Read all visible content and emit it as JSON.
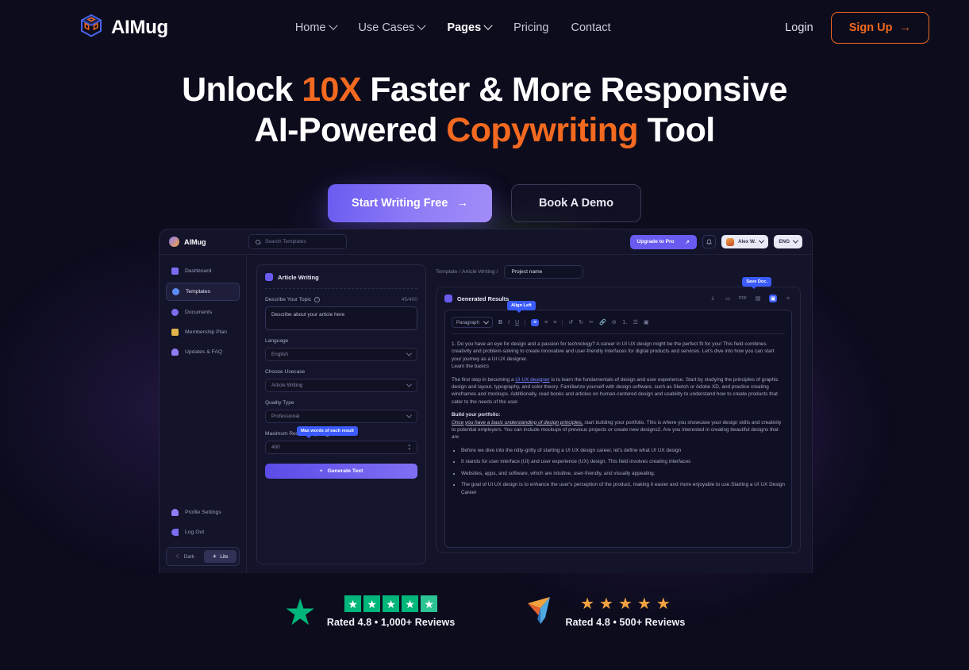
{
  "brand": {
    "name": "AIMug",
    "logo_icon": "cube-logo-icon"
  },
  "nav": {
    "items": [
      {
        "label": "Home",
        "has_caret": true,
        "active": false
      },
      {
        "label": "Use Cases",
        "has_caret": true,
        "active": false
      },
      {
        "label": "Pages",
        "has_caret": true,
        "active": true
      },
      {
        "label": "Pricing",
        "has_caret": false,
        "active": false
      },
      {
        "label": "Contact",
        "has_caret": false,
        "active": false
      }
    ],
    "login": "Login",
    "signup": "Sign Up",
    "signup_arrow": "→"
  },
  "hero": {
    "line1_a": "Unlock ",
    "line1_accent": "10X",
    "line1_b": " Faster & More Responsive",
    "line2_a": "AI-Powered ",
    "line2_accent": "Copywriting",
    "line2_b": " Tool",
    "cta_primary": "Start Writing Free",
    "cta_primary_arrow": "→",
    "cta_secondary": "Book A Demo",
    "accent_color": "#f2691f",
    "primary_btn_color": "#6a5bf0"
  },
  "app": {
    "brand": "AIMug",
    "search_placeholder": "Search Templates",
    "upgrade_label": "Upgrade to Pro",
    "upgrade_arrow": "↗",
    "bell_icon": "bell-icon",
    "user_name": "Alex W.",
    "language": "ENG",
    "sidebar": {
      "items": [
        {
          "label": "Dashboard",
          "icon": "dashboard-icon",
          "color": "#7b6cf0",
          "active": false
        },
        {
          "label": "Templates",
          "icon": "templates-icon",
          "color": "#5f8df7",
          "active": true
        },
        {
          "label": "Documents",
          "icon": "documents-icon",
          "color": "#7b6cf0",
          "active": false
        },
        {
          "label": "Membership Plan",
          "icon": "membership-icon",
          "color": "#e0b44a",
          "active": false
        },
        {
          "label": "Updates & FAQ",
          "icon": "updates-icon",
          "color": "#8f7df7",
          "active": false
        }
      ],
      "bottom_items": [
        {
          "label": "Profile Settings",
          "icon": "profile-icon"
        },
        {
          "label": "Log Out",
          "icon": "logout-icon"
        }
      ],
      "theme": {
        "dark_label": "Dark",
        "dark_icon": "moon-icon",
        "light_label": "Lite",
        "light_icon": "sun-icon",
        "selected": "Lite"
      }
    },
    "form": {
      "title": "Article Writing",
      "topic_label": "Describe Your Topic",
      "topic_count": "45/400",
      "topic_value": "Describe about your article here",
      "language_label": "Language",
      "language_value": "English",
      "usecase_label": "Choose Usecase",
      "usecase_value": "Article Writing",
      "quality_label": "Quality Type",
      "quality_value": "Professional",
      "maxlen_label": "Maximum Result Length",
      "maxlen_value": "400",
      "maxlen_tooltip": "Max words of each result",
      "generate_label": "Generate Text",
      "generate_plus": "+"
    },
    "editor": {
      "breadcrumb": "Template / Article Writing /",
      "project_name": "Project name",
      "results_title": "Generated Results",
      "save_tooltip": "Save Doc.",
      "toolbar_icons": [
        "download-icon",
        "comment-icon",
        "pdf-icon",
        "file-icon",
        "save-icon",
        "share-icon"
      ],
      "format_select": "Paragraph",
      "format_icons": [
        "bold-icon",
        "italic-icon",
        "underline-icon",
        "align-left-icon",
        "align-center-icon",
        "align-right-icon",
        "undo-icon",
        "redo-icon",
        "eraser-icon",
        "link-icon",
        "unlink-icon",
        "list-ordered-icon",
        "list-bullet-icon",
        "image-icon"
      ],
      "align_tooltip": "Align Left",
      "p1": "1. Do you have an eye for design and a passion for technology? A career in UI UX design might be the perfect fit for you! This field combines creativity and problem-solving to create innovative and user-friendly interfaces for digital products and services. Let's dive into how you can start your journey as a UI UX designer.",
      "p1b": "Learn the basics",
      "p2_a": "The first step in becoming a ",
      "p2_link": "UI UX designer",
      "p2_b": " is to learn the fundamentals of design and user experience. Start by studying the principles of graphic design and layout, typography, and color theory. Familiarize yourself with design software, such as Sketch or Adobe XD, and practice creating wireframes and mockups. Additionally, read books and articles on human-centered design and usability to understand how to create products that cater to the needs of the user.",
      "p3_heading": "Build your portfolio:",
      "p3_ital": "Once you have a basic understanding of design principles,",
      "p3_rest": " start building your portfolio. This is where you showcase your design skills and creativity to potential employers. You can include mockups of previous projects or create new designs2. Are you interested in creating beautiful designs that are",
      "bullets": [
        "Before we dive into the nitty-gritty of starting a UI UX design career, let's define what UI UX design",
        "It stands for user interface (UI) and user experience (UX) design. This field involves creating interfaces",
        "Websites, apps, and software, which are intuitive, user-friendly, and visually appealing.",
        "The goal of UI UX design is to enhance the user's perception of the product, making it easier and more enjoyable to use.Starting a UI UX Design Career"
      ]
    }
  },
  "ratings": [
    {
      "provider": "trustpilot",
      "logo_icon": "trustpilot-star-icon",
      "stars": 5,
      "star_style": "square-green",
      "label": "Rated 4.8 • 1,000+ Reviews",
      "color": "#00b67a"
    },
    {
      "provider": "capterra",
      "logo_icon": "capterra-arrow-icon",
      "stars": 5,
      "star_style": "gold",
      "label": "Rated 4.8 • 500+ Reviews",
      "color": "#f2a23f"
    }
  ]
}
